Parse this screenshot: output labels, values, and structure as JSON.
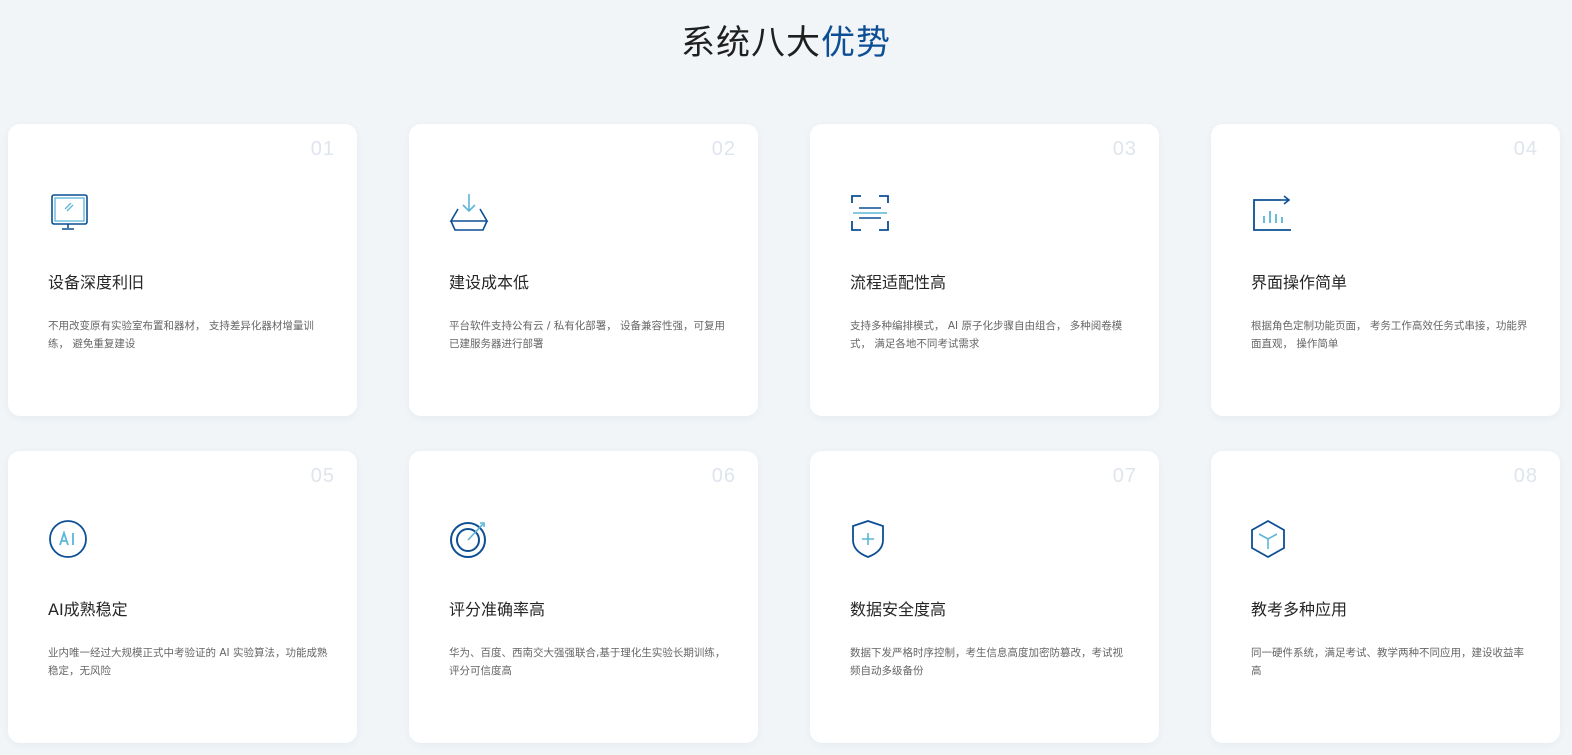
{
  "section": {
    "title_main": "系统八大",
    "title_highlight": "优势"
  },
  "cards": [
    {
      "num": "01",
      "title": "设备深度利旧",
      "desc": "不用改变原有实验室布置和器材， 支持差异化器材增量训练， 避免重复建设",
      "icon": "monitor-icon"
    },
    {
      "num": "02",
      "title": "建设成本低",
      "desc": "平台软件支持公有云 / 私有化部署， 设备兼容性强，可复用已建服务器进行部署",
      "icon": "download-tray-icon"
    },
    {
      "num": "03",
      "title": "流程适配性高",
      "desc": "支持多种编排模式， AI 原子化步骤自由组合， 多种阅卷模式， 满足各地不同考试需求",
      "icon": "scan-frame-icon"
    },
    {
      "num": "04",
      "title": "界面操作简单",
      "desc": "根据角色定制功能页面， 考务工作高效任务式串接，功能界面直观， 操作简单",
      "icon": "chart-export-icon"
    },
    {
      "num": "05",
      "title": "AI成熟稳定",
      "desc": "业内唯一经过大规模正式中考验证的 AI 实验算法，功能成熟稳定，无风险",
      "icon": "ai-badge-icon"
    },
    {
      "num": "06",
      "title": "评分准确率高",
      "desc": "华为、百度、西南交大强强联合,基于理化生实验长期训练，评分可信度高",
      "icon": "target-icon"
    },
    {
      "num": "07",
      "title": "数据安全度高",
      "desc": "数据下发严格时序控制，考生信息高度加密防篡改，考试视频自动多级备份",
      "icon": "shield-plus-icon"
    },
    {
      "num": "08",
      "title": "教考多种应用",
      "desc": "同一硬件系统，满足考试、教学两种不同应用，建设收益率高",
      "icon": "cube-icon"
    }
  ],
  "colors": {
    "primary": "#0d4f94",
    "accent": "#5bb5d8"
  }
}
